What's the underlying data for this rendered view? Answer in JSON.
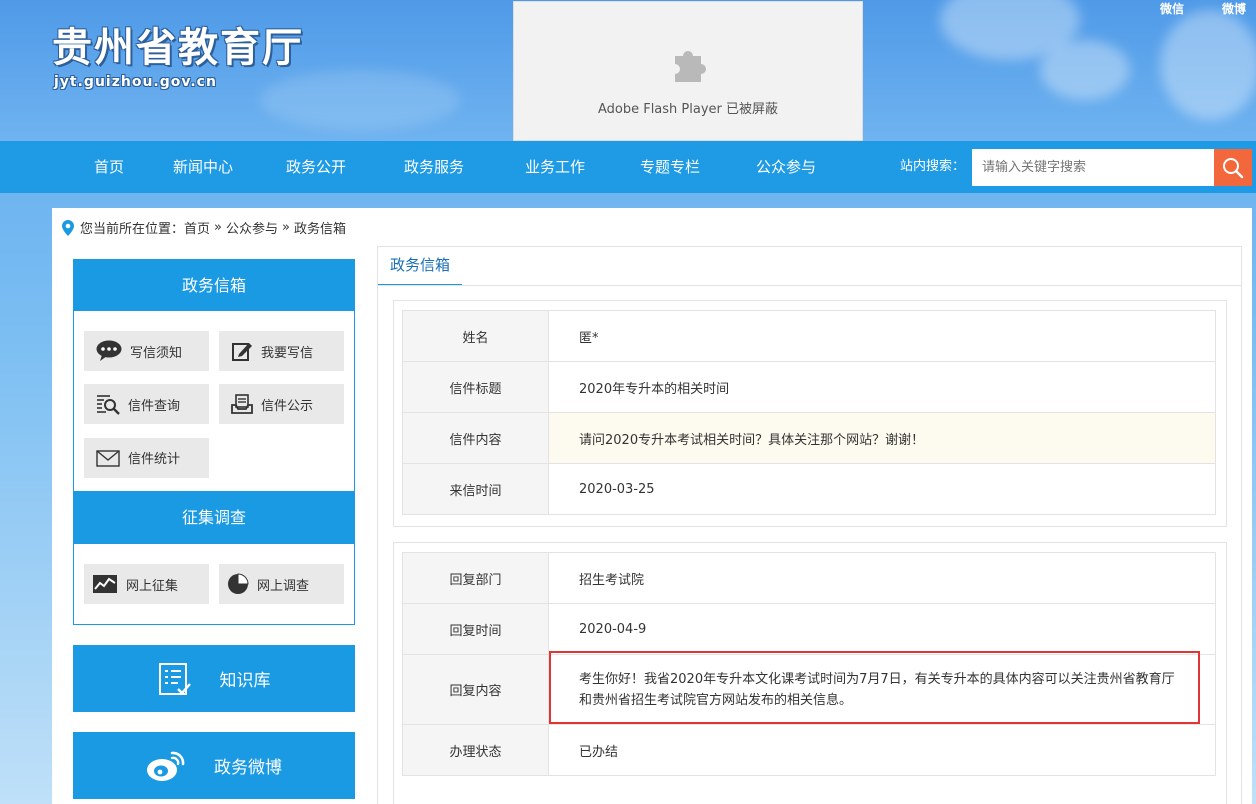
{
  "header": {
    "site_title": "贵州省教育厅",
    "site_url": "jyt.guizhou.gov.cn",
    "flash_notice": "Adobe Flash Player 已被屏蔽",
    "top_links": [
      "微信",
      "微博"
    ]
  },
  "nav": {
    "items": [
      "首页",
      "新闻中心",
      "政务公开",
      "政务服务",
      "业务工作",
      "专题专栏",
      "公众参与"
    ],
    "search_label": "站内搜索：",
    "search_placeholder": "请输入关键字搜索"
  },
  "breadcrumb": {
    "prefix": "您当前所在位置：",
    "home": "首页",
    "sep1": "»",
    "level1": "公众参与",
    "sep2": "»",
    "current": "政务信箱"
  },
  "sidebar": {
    "mailbox_title": "政务信箱",
    "mailbox_buttons": [
      "写信须知",
      "我要写信",
      "信件查询",
      "信件公示",
      "信件统计"
    ],
    "survey_title": "征集调查",
    "survey_buttons": [
      "网上征集",
      "网上调查"
    ],
    "knowledge_label": "知识库",
    "weibo_label": "政务微博"
  },
  "content": {
    "tab_label": "政务信箱",
    "letter": [
      {
        "label": "姓名",
        "value": "匿*"
      },
      {
        "label": "信件标题",
        "value": "2020年专升本的相关时间"
      },
      {
        "label": "信件内容",
        "value": "请问2020专升本考试相关时间？具体关注那个网站？谢谢！"
      },
      {
        "label": "来信时间",
        "value": "2020-03-25"
      }
    ],
    "reply": [
      {
        "label": "回复部门",
        "value": "招生考试院"
      },
      {
        "label": "回复时间",
        "value": "2020-04-9"
      },
      {
        "label": "回复内容",
        "value": "考生你好！我省2020年专升本文化课考试时间为7月7日，有关专升本的具体内容可以关注贵州省教育厅和贵州省招生考试院官方网站发布的相关信息。"
      },
      {
        "label": "办理状态",
        "value": "已办结"
      }
    ]
  },
  "colors": {
    "nav_blue": "#1e9be4",
    "panel_blue": "#1a9ae2",
    "search_button": "#f2683c",
    "highlight_border": "#e03535"
  }
}
